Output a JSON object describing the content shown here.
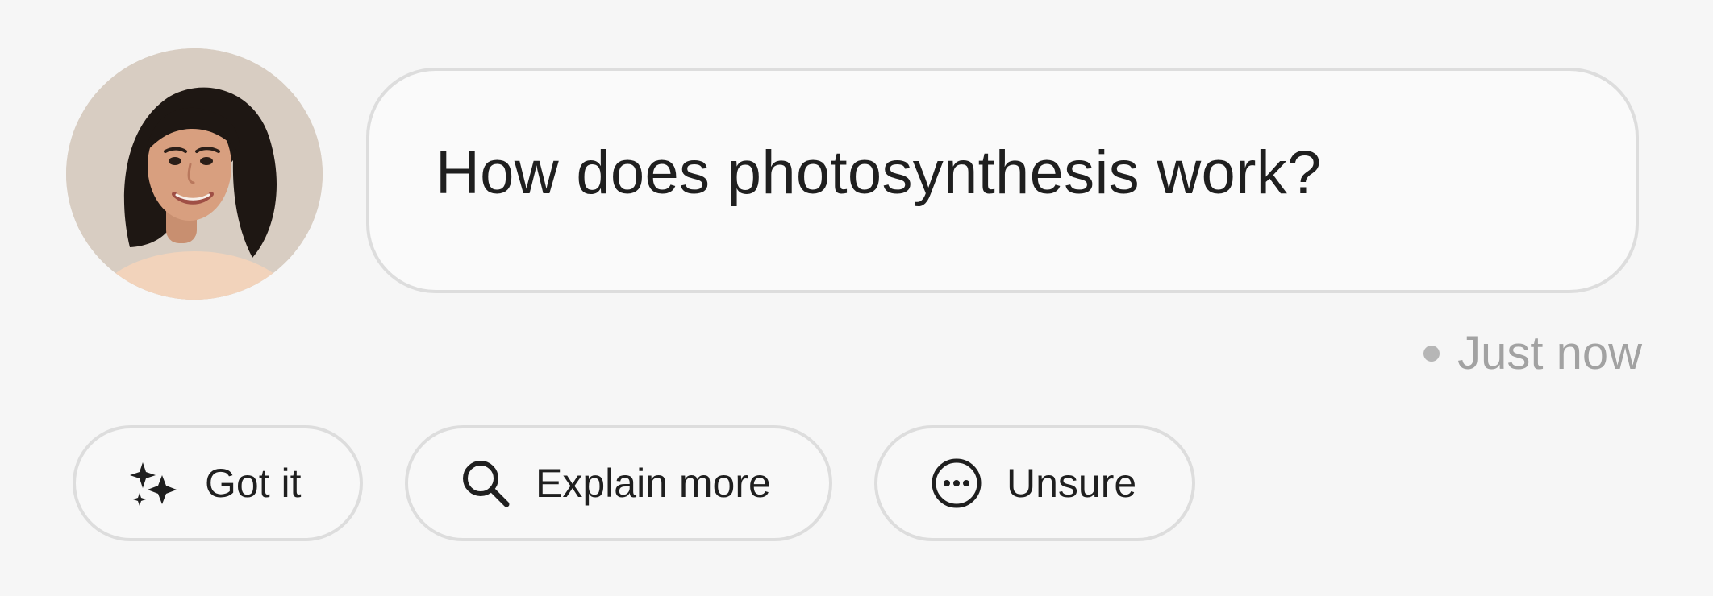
{
  "message": {
    "text": "How does photosynthesis work?",
    "status": "Just now"
  },
  "actions": [
    {
      "label": "Got it",
      "icon": "sparkles-icon"
    },
    {
      "label": "Explain more",
      "icon": "search-icon"
    },
    {
      "label": "Unsure",
      "icon": "more-horizontal-icon"
    }
  ],
  "colors": {
    "background": "#f6f6f6",
    "border": "#dddddd",
    "text": "#1f1f1f",
    "muted": "#a2a2a2"
  }
}
